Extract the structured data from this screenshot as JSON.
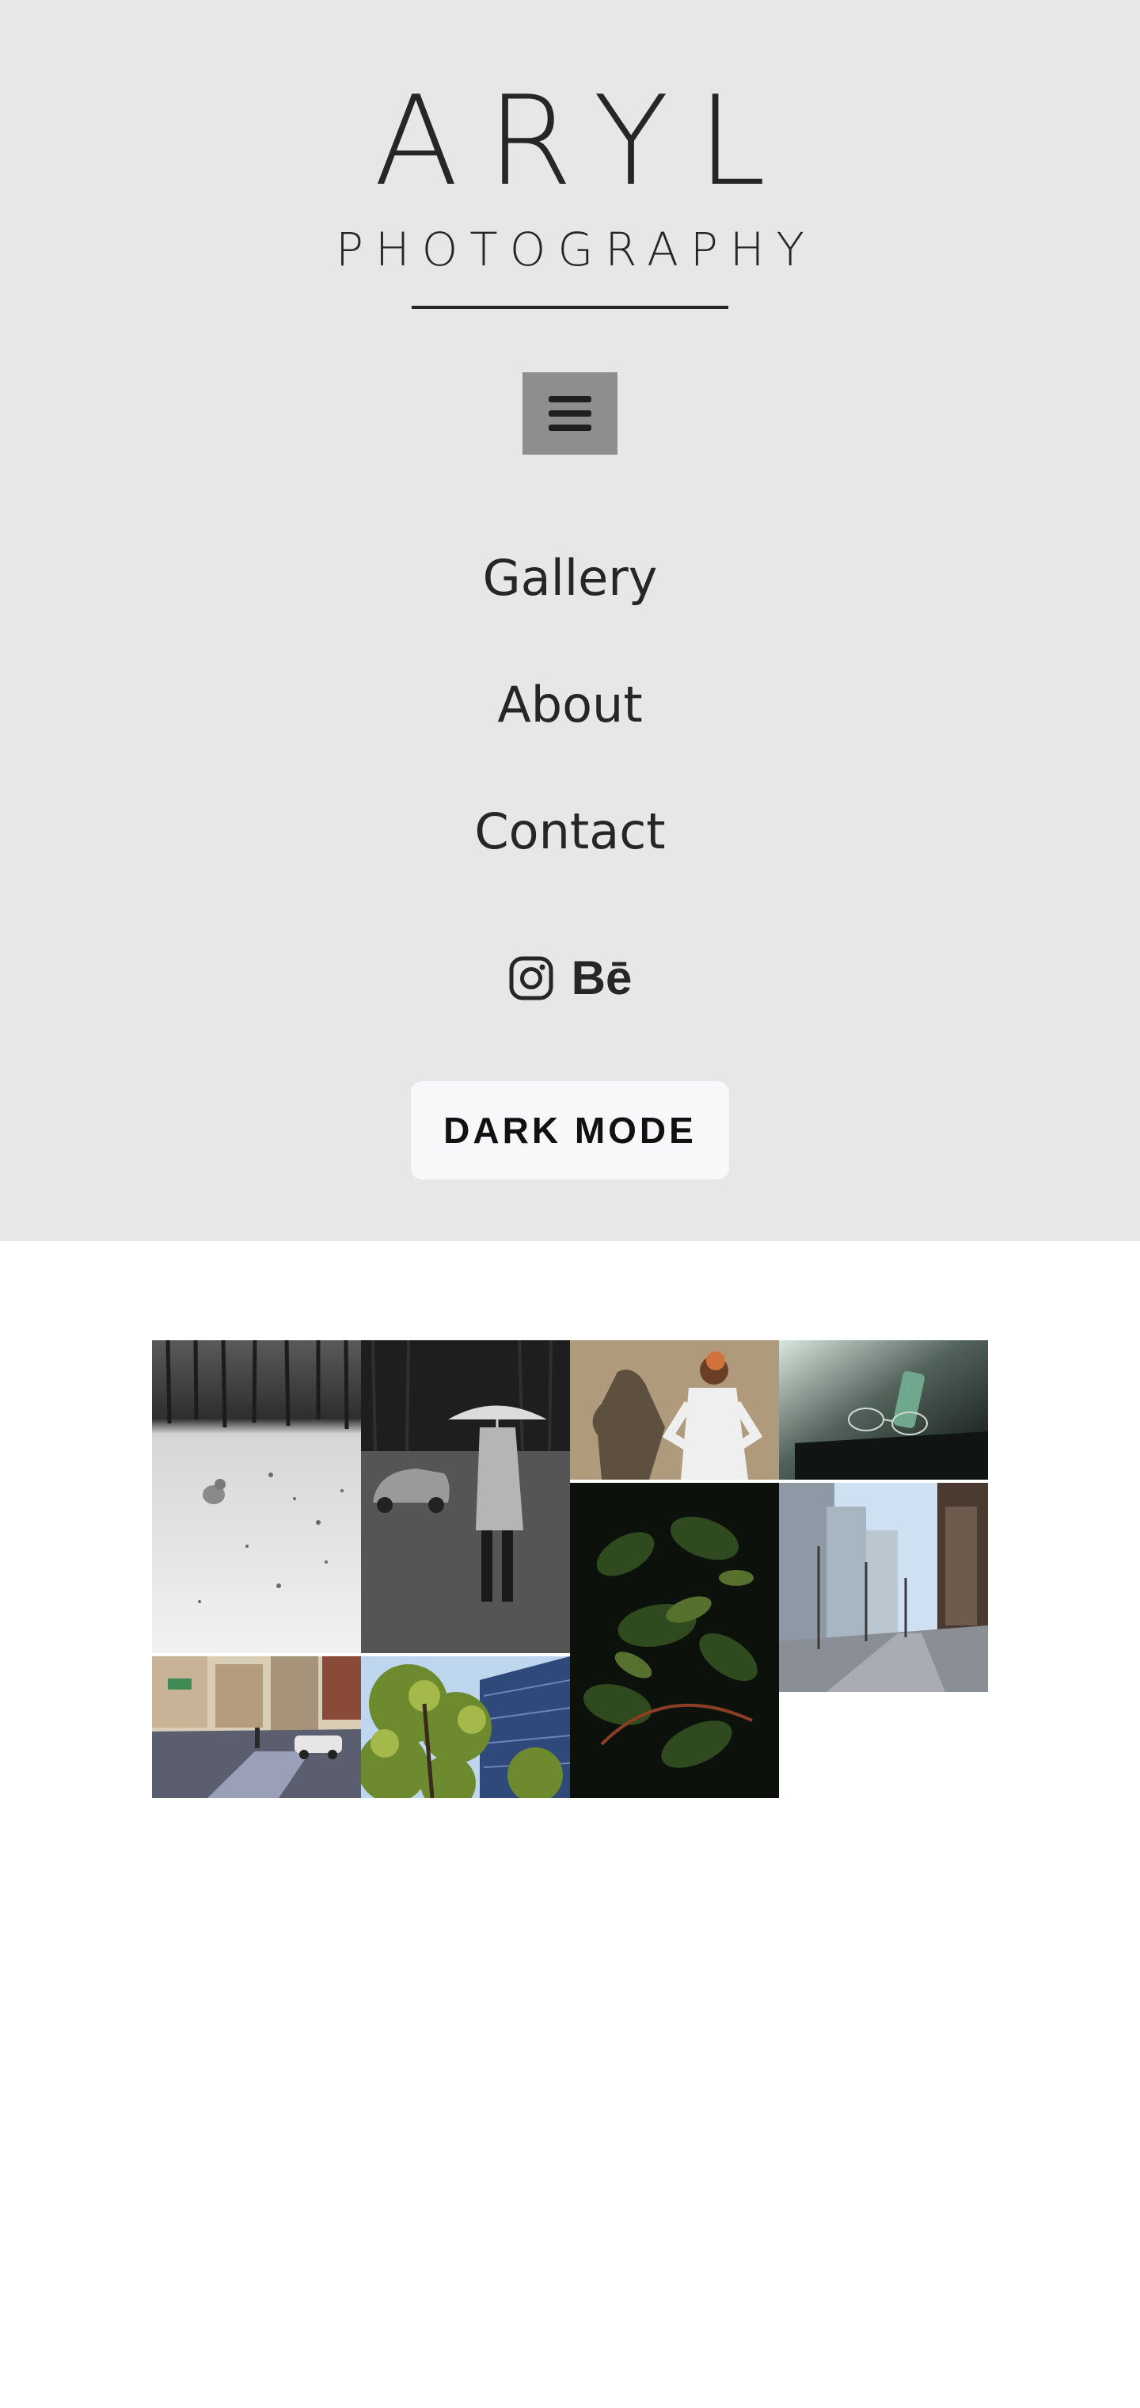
{
  "brand": {
    "title": "ARYL",
    "subtitle": "PHOTOGRAPHY"
  },
  "menu_button": {
    "icon": "hamburger-menu-icon"
  },
  "nav": {
    "items": [
      {
        "label": "Gallery"
      },
      {
        "label": "About"
      },
      {
        "label": "Contact"
      }
    ]
  },
  "social": {
    "instagram_icon": "instagram-icon",
    "behance_label": "Bē"
  },
  "dark_mode_button": {
    "label": "DARK MODE"
  },
  "colors": {
    "header_bg": "#e7e7e7",
    "text": "#262626",
    "menu_button_bg": "#8e8e8e",
    "button_bg": "#f7f8fa",
    "page_bg": "#ffffff"
  },
  "gallery": {
    "photos": [
      {
        "subject": "cat-in-snow"
      },
      {
        "subject": "person-with-umbrella"
      },
      {
        "subject": "woman-in-white-shadow"
      },
      {
        "subject": "glasses-on-table"
      },
      {
        "subject": "leaves-closeup"
      },
      {
        "subject": "city-street-trees"
      },
      {
        "subject": "city-intersection"
      },
      {
        "subject": "tree-and-building"
      }
    ]
  }
}
